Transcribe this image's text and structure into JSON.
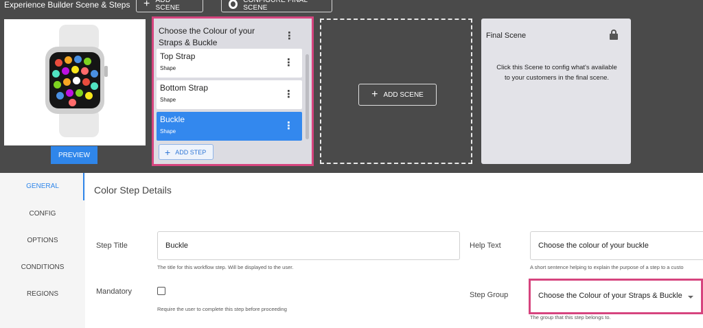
{
  "header": {
    "title": "Experience Builder Scene & Steps",
    "add_scene_label": "ADD SCENE",
    "configure_final_label": "CONFIGURE FINAL SCENE"
  },
  "preview": {
    "button_label": "PREVIEW"
  },
  "scene": {
    "title": "Choose the Colour of your Straps & Buckle",
    "steps": [
      {
        "title": "Top Strap",
        "subtitle": "Shape",
        "active": false
      },
      {
        "title": "Bottom Strap",
        "subtitle": "Shape",
        "active": false
      },
      {
        "title": "Buckle",
        "subtitle": "Shape",
        "active": true
      }
    ],
    "add_step_label": "ADD STEP"
  },
  "empty_scene": {
    "add_scene_label": "ADD SCENE"
  },
  "final_scene": {
    "title": "Final Scene",
    "description": "Click this Scene to config what's available to your customers in the final scene."
  },
  "sidebar": {
    "items": [
      {
        "label": "GENERAL",
        "active": true
      },
      {
        "label": "CONFIG",
        "active": false
      },
      {
        "label": "OPTIONS",
        "active": false
      },
      {
        "label": "CONDITIONS",
        "active": false
      },
      {
        "label": "REGIONS",
        "active": false
      }
    ]
  },
  "details": {
    "section_title": "Color Step Details",
    "step_title_label": "Step Title",
    "step_title_value": "Buckle",
    "step_title_hint": "The title for this workflow step. Will be displayed to the user.",
    "help_text_label": "Help Text",
    "help_text_value": "Choose the colour of your buckle",
    "help_text_hint": "A short sentence helping to explain the purpose of a step to a custo",
    "mandatory_label": "Mandatory",
    "mandatory_hint": "Require the user to complete this step before proceeding",
    "step_group_label": "Step Group",
    "step_group_value": "Choose the Colour of your Straps & Buckle",
    "step_group_hint": "The group that this step belongs to."
  },
  "colors": {
    "accent": "#2f86ea",
    "highlight": "#d6447e",
    "dark_bg": "#4a4a4a"
  }
}
